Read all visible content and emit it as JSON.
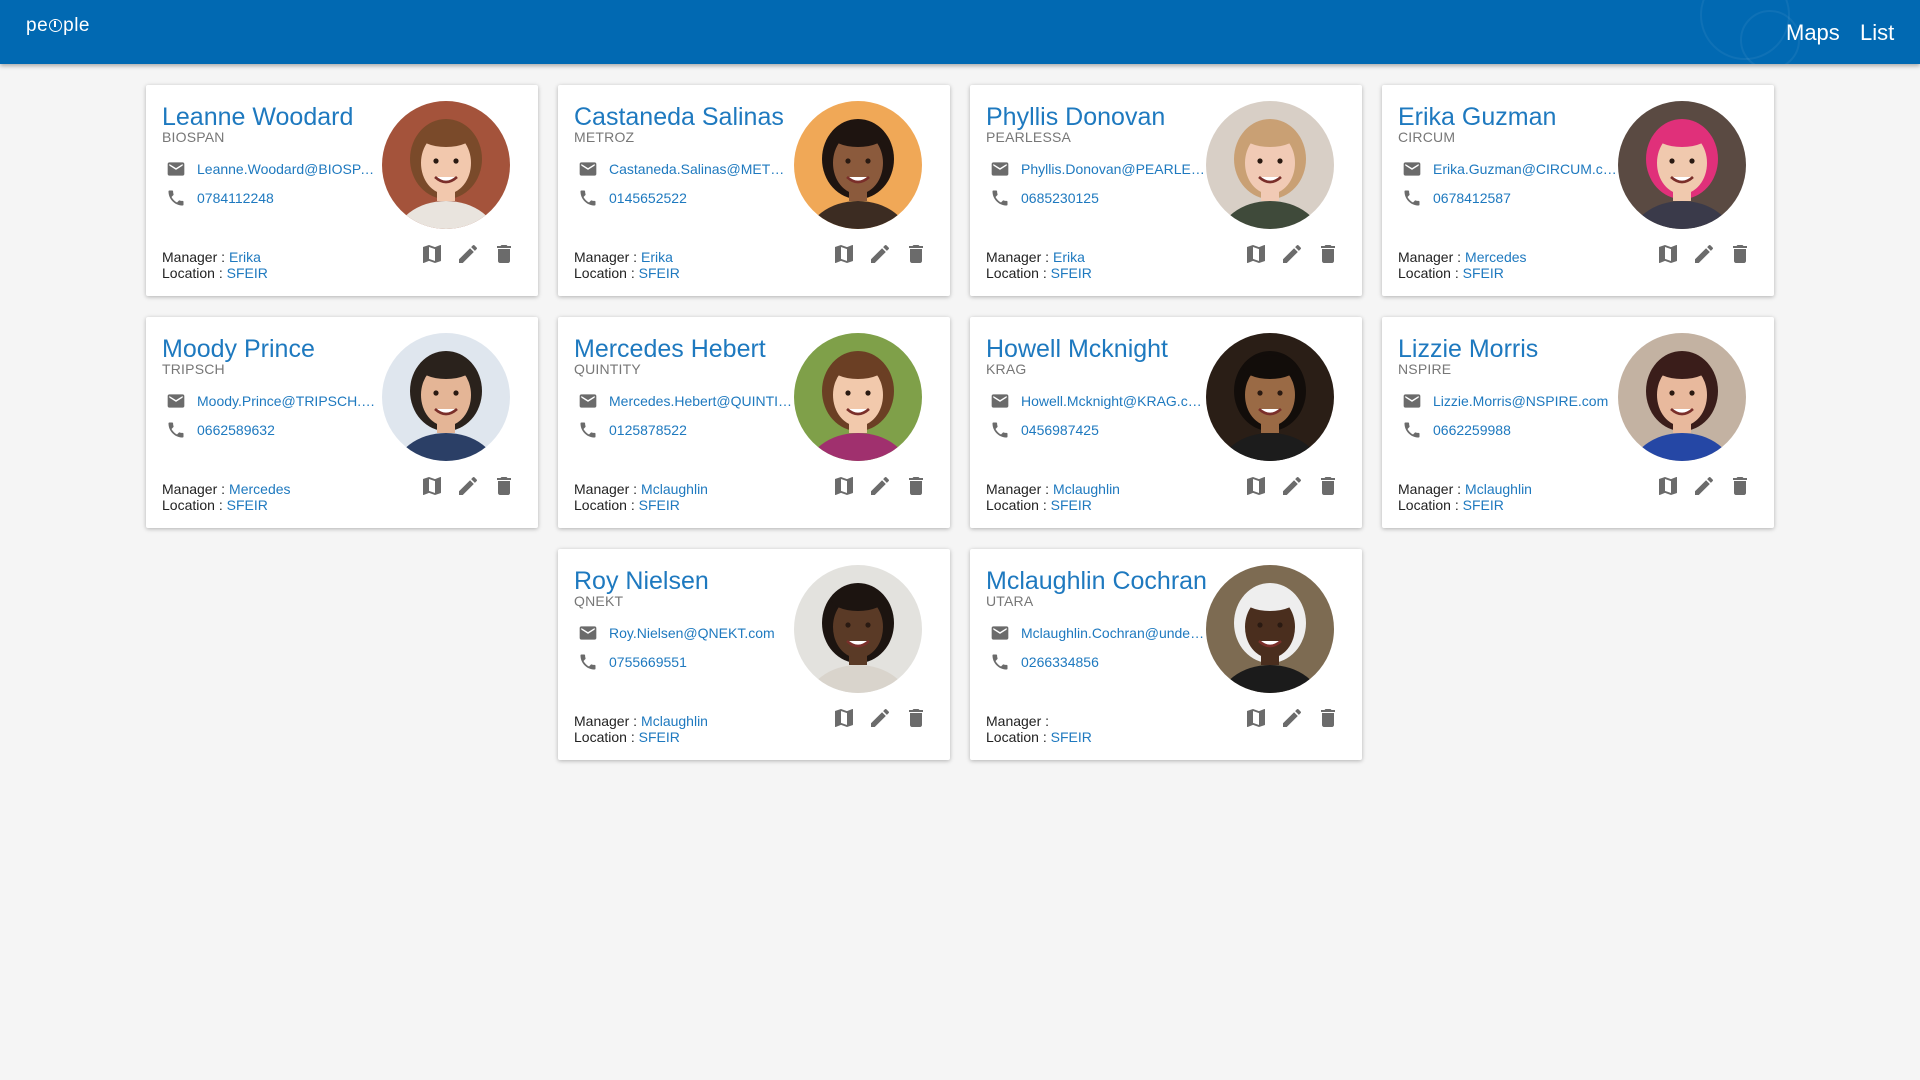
{
  "app": {
    "logo": "people"
  },
  "header": {
    "nav": [
      {
        "label": "Maps"
      },
      {
        "label": "List"
      }
    ]
  },
  "labels": {
    "manager": "Manager :",
    "location": "Location :"
  },
  "people": [
    {
      "name": "Leanne Woodard",
      "company": "BIOSPAN",
      "email": "Leanne.Woodard@BIOSPAN.com",
      "phone": "0784112248",
      "manager": "Erika",
      "location": "SFEIR",
      "photo": {
        "bg": "#a4533b",
        "skin": "#f2c8ad",
        "hair": "#7a4a2a",
        "shirt": "#e9e4de"
      }
    },
    {
      "name": "Castaneda Salinas",
      "company": "METROZ",
      "email": "Castaneda.Salinas@METROZ.com",
      "phone": "0145652522",
      "manager": "Erika",
      "location": "SFEIR",
      "photo": {
        "bg": "#f0a857",
        "skin": "#8b5a3c",
        "hair": "#1e1410",
        "shirt": "#3c2c22"
      }
    },
    {
      "name": "Phyllis Donovan",
      "company": "PEARLESSA",
      "email": "Phyllis.Donovan@PEARLESSA.com",
      "phone": "0685230125",
      "manager": "Erika",
      "location": "SFEIR",
      "photo": {
        "bg": "#d8cfc6",
        "skin": "#f1cab5",
        "hair": "#c9a074",
        "shirt": "#3f4a3a"
      }
    },
    {
      "name": "Erika Guzman",
      "company": "CIRCUM",
      "email": "Erika.Guzman@CIRCUM.com",
      "phone": "0678412587",
      "manager": "Mercedes",
      "location": "SFEIR",
      "photo": {
        "bg": "#5a4a42",
        "skin": "#f0c9ae",
        "hair": "#e0307a",
        "shirt": "#3a3a4a"
      }
    },
    {
      "name": "Moody Prince",
      "company": "TRIPSCH",
      "email": "Moody.Prince@TRIPSCH.com",
      "phone": "0662589632",
      "manager": "Mercedes",
      "location": "SFEIR",
      "photo": {
        "bg": "#dfe6ee",
        "skin": "#e4b596",
        "hair": "#2a221c",
        "shirt": "#2b3f66"
      }
    },
    {
      "name": "Mercedes Hebert",
      "company": "QUINTITY",
      "email": "Mercedes.Hebert@QUINTITY.com",
      "phone": "0125878522",
      "manager": "Mclaughlin",
      "location": "SFEIR",
      "photo": {
        "bg": "#7fa049",
        "skin": "#f2c9ac",
        "hair": "#6b3f24",
        "shirt": "#a0306e"
      }
    },
    {
      "name": "Howell Mcknight",
      "company": "KRAG",
      "email": "Howell.Mcknight@KRAG.com",
      "phone": "0456987425",
      "manager": "Mclaughlin",
      "location": "SFEIR",
      "photo": {
        "bg": "#2a1e16",
        "skin": "#9a6a45",
        "hair": "#120d0a",
        "shirt": "#1c1c1c"
      }
    },
    {
      "name": "Lizzie Morris",
      "company": "NSPIRE",
      "email": "Lizzie.Morris@NSPIRE.com",
      "phone": "0662259988",
      "manager": "Mclaughlin",
      "location": "SFEIR",
      "photo": {
        "bg": "#c3b2a2",
        "skin": "#e8b99d",
        "hair": "#3a1d1a",
        "shirt": "#2547a5"
      }
    },
    {
      "name": "Roy Nielsen",
      "company": "QNEKT",
      "email": "Roy.Nielsen@QNEKT.com",
      "phone": "0755669551",
      "manager": "Mclaughlin",
      "location": "SFEIR",
      "photo": {
        "bg": "#e3e2de",
        "skin": "#5a3a26",
        "hair": "#1c1410",
        "shirt": "#d9d4cc"
      }
    },
    {
      "name": "Mclaughlin Cochran",
      "company": "UTARA",
      "email": "Mclaughlin.Cochran@undefined.com",
      "phone": "0266334856",
      "manager": "",
      "location": "SFEIR",
      "photo": {
        "bg": "#7d6b52",
        "skin": "#4a2e1e",
        "hair": "#eeeeee",
        "shirt": "#1b1b1b"
      }
    }
  ]
}
